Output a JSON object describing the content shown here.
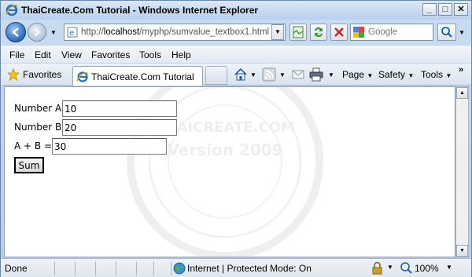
{
  "window": {
    "title": "ThaiCreate.Com Tutorial - Windows Internet Explorer",
    "min": "_",
    "max": "□",
    "close": "✕"
  },
  "address": {
    "prefix": "http://",
    "host": "localhost",
    "path": "/myphp/sumvalue_textbox1.html"
  },
  "search": {
    "placeholder": "Google"
  },
  "menu": [
    "File",
    "Edit",
    "View",
    "Favorites",
    "Tools",
    "Help"
  ],
  "favorites": {
    "label": "Favorites"
  },
  "tab": {
    "label": "ThaiCreate.Com Tutorial"
  },
  "commands": {
    "page": "Page",
    "safety": "Safety",
    "tools": "Tools"
  },
  "form": {
    "label_a": "Number A",
    "value_a": "10",
    "label_b": "Number B",
    "value_b": "20",
    "label_sum": "A + B =",
    "value_sum": "30",
    "button": "Sum"
  },
  "watermark": {
    "line1": "THAICREATE.COM",
    "line2": "Version 2009"
  },
  "status": {
    "text": "Done",
    "zone": "Internet | Protected Mode: On",
    "zoom": "100%"
  }
}
